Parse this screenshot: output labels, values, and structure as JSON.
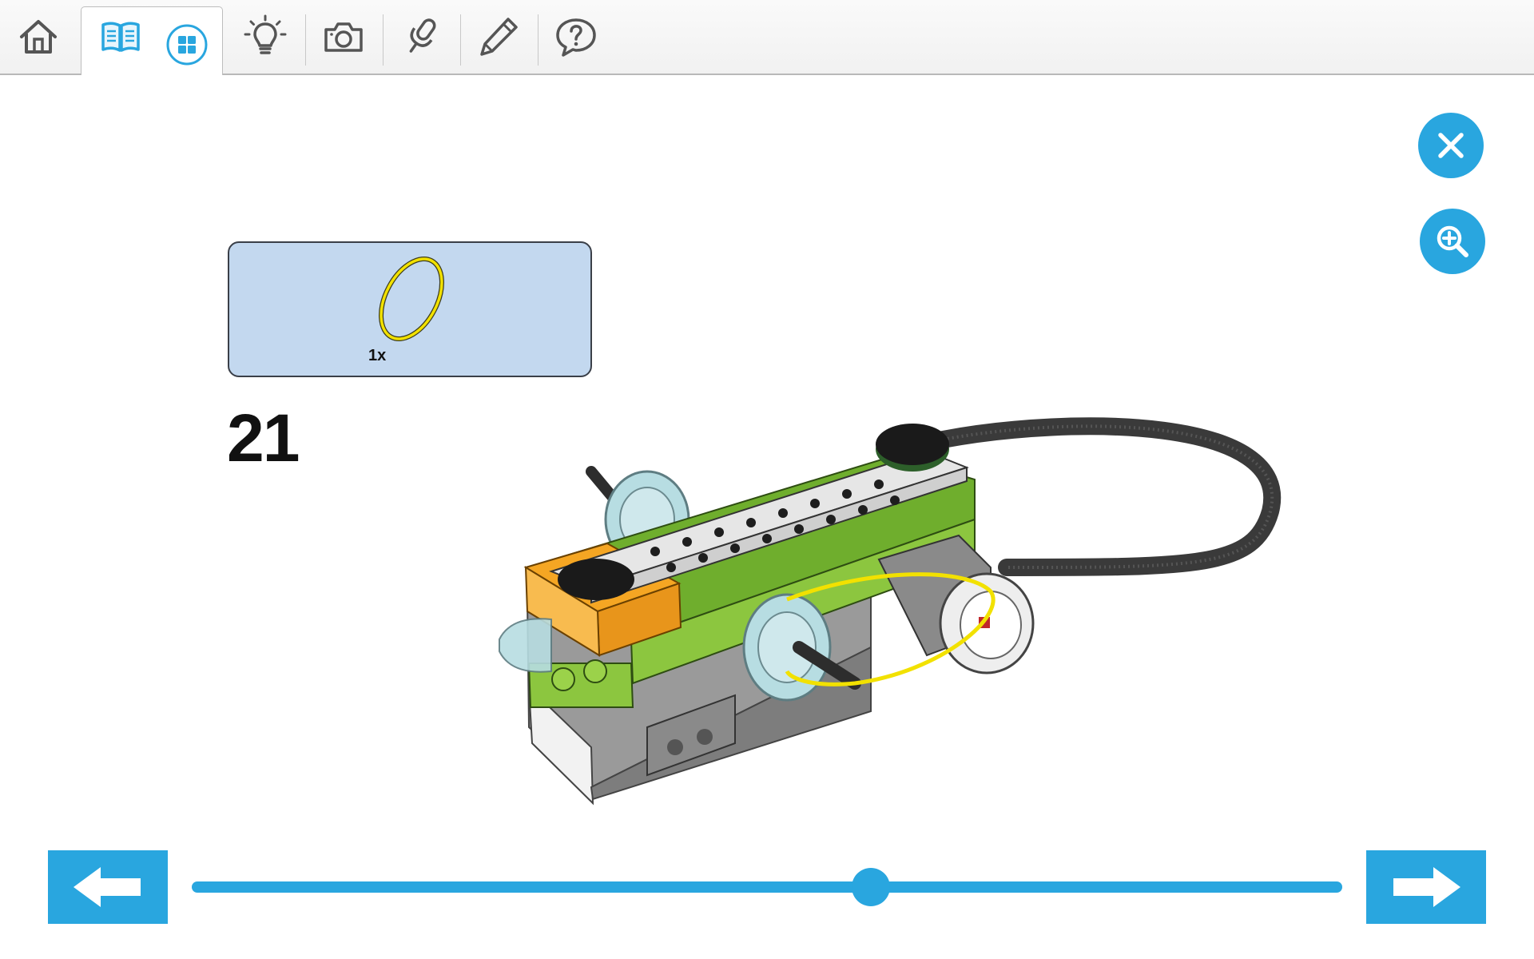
{
  "toolbar": {
    "buttons": [
      {
        "icon": "home-icon"
      },
      {
        "icon": "book-icon"
      },
      {
        "icon": "grid-icon"
      },
      {
        "icon": "lightbulb-icon"
      },
      {
        "icon": "camera-icon"
      },
      {
        "icon": "microphone-icon"
      },
      {
        "icon": "pencil-icon"
      },
      {
        "icon": "help-bubble-icon"
      }
    ]
  },
  "actions": {
    "close_icon": "close-icon",
    "zoom_icon": "zoom-in-icon"
  },
  "step": {
    "number": "21",
    "parts": [
      {
        "name": "rubber band",
        "color": "#f2e100",
        "quantity": "1x"
      }
    ]
  },
  "navigation": {
    "prev_icon": "arrow-left-icon",
    "next_icon": "arrow-right-icon",
    "progress": 0.59
  },
  "colors": {
    "accent": "#29a6df",
    "parts_box": "#c3d8ef",
    "brick_green": "#8cc63f",
    "brick_orange": "#f5a623"
  }
}
